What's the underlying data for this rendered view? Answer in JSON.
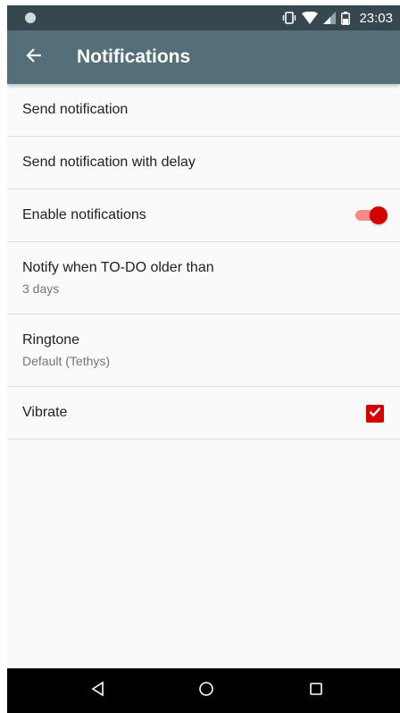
{
  "status_bar": {
    "time": "23:03",
    "icons": [
      "notification-dot-icon",
      "vibrate-icon",
      "wifi-icon",
      "signal-icon",
      "battery-icon"
    ]
  },
  "app_bar": {
    "title": "Notifications",
    "back_icon": "arrow-back-icon",
    "background": "#546e7a",
    "status_background": "#37474f"
  },
  "preferences": {
    "send_notification": {
      "title": "Send notification"
    },
    "send_delayed": {
      "title": "Send notification with delay"
    },
    "enable_notifications": {
      "title": "Enable notifications",
      "enabled": true
    },
    "notify_older": {
      "title": "Notify when TO-DO older than",
      "summary": "3 days"
    },
    "ringtone": {
      "title": "Ringtone",
      "summary": "Default (Tethys)"
    },
    "vibrate": {
      "title": "Vibrate",
      "checked": true
    }
  },
  "accent_color": "#d50000",
  "nav_bar": {
    "buttons": [
      "back-triangle-icon",
      "home-circle-icon",
      "recents-square-icon"
    ]
  }
}
